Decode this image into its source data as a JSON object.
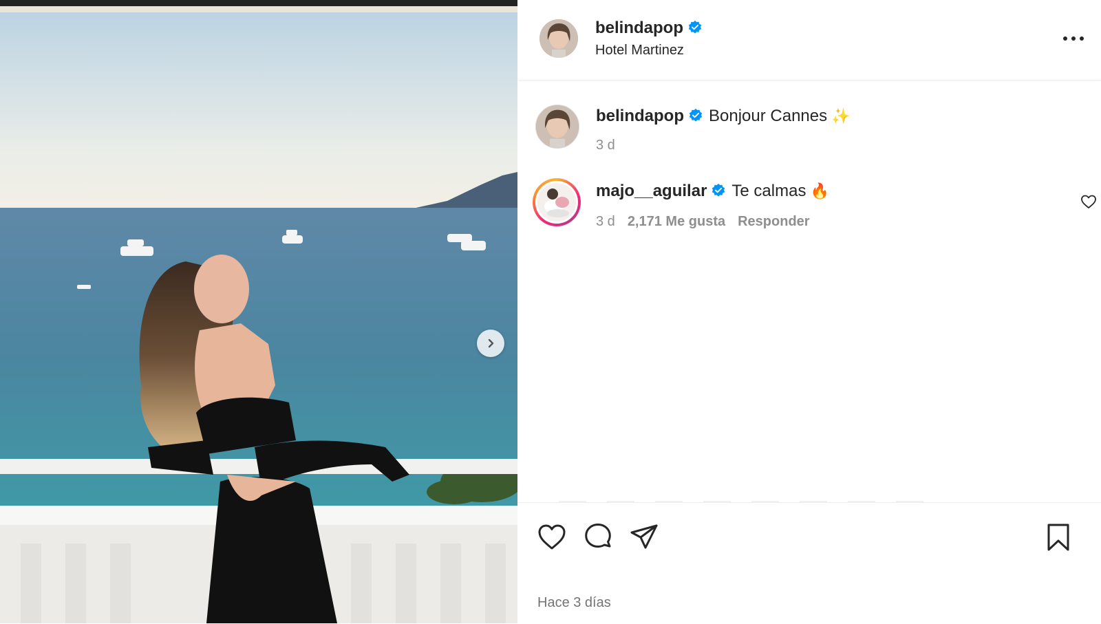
{
  "post": {
    "author": "belindapop",
    "location": "Hotel Martinez",
    "verified": true,
    "timestamp": "Hace 3 días"
  },
  "caption": {
    "username": "belindapop",
    "text": "Bonjour Cannes",
    "emoji": "✨",
    "time": "3 d"
  },
  "comments": [
    {
      "username": "majo__aguilar",
      "text": "Te calmas",
      "emoji": "🔥",
      "time": "3 d",
      "likes": "2,171 Me gusta",
      "reply_label": "Responder"
    }
  ],
  "icons": {
    "verified": "verified-badge-icon",
    "more": "more-options-icon",
    "like": "heart-icon",
    "comment": "comment-icon",
    "share": "send-icon",
    "save": "bookmark-icon",
    "next": "chevron-right-icon"
  },
  "colors": {
    "verified_blue": "#0095f6",
    "text": "#262626",
    "secondary": "#8e8e8e"
  }
}
